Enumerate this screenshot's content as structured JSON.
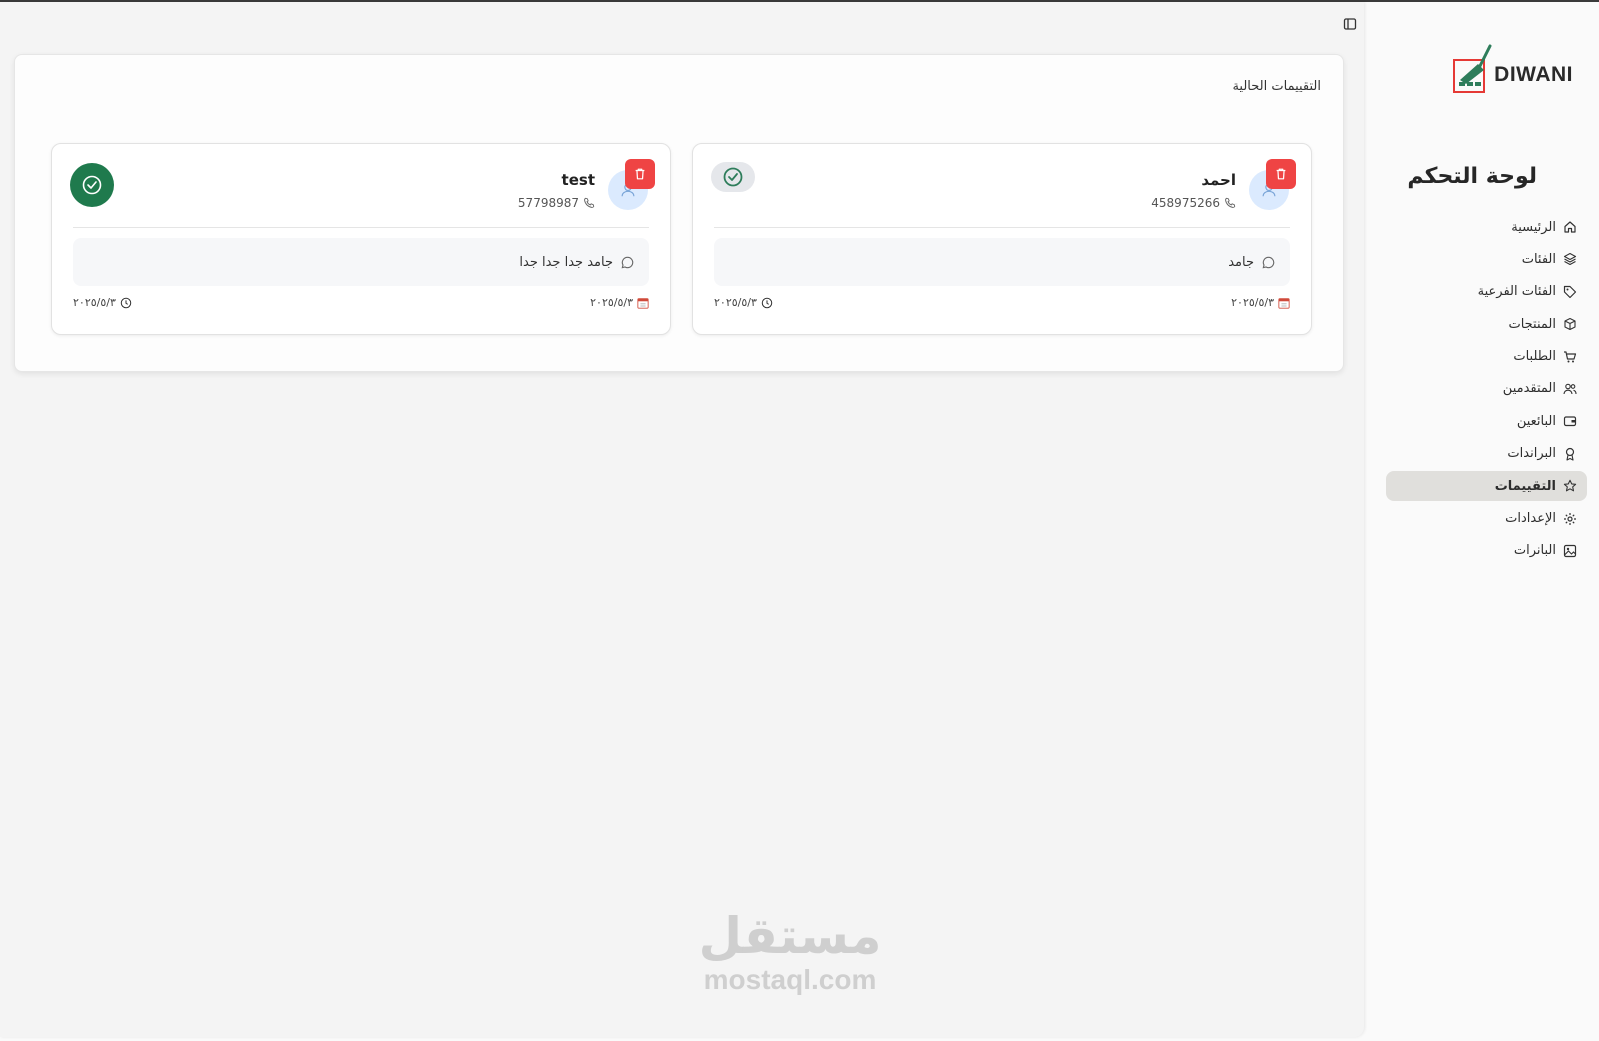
{
  "brand": {
    "logo_text": "DIWANI",
    "accent": "#e53935",
    "green": "#2e7d5b"
  },
  "sidebar": {
    "title": "لوحة التحكم",
    "items": [
      {
        "label": "الرئيسية",
        "icon": "home-icon"
      },
      {
        "label": "الفئات",
        "icon": "layers-icon"
      },
      {
        "label": "الفئات الفرعية",
        "icon": "tag-icon"
      },
      {
        "label": "المنتجات",
        "icon": "box-icon"
      },
      {
        "label": "الطلبات",
        "icon": "cart-icon"
      },
      {
        "label": "المتقدمين",
        "icon": "users-icon"
      },
      {
        "label": "البائعين",
        "icon": "wallet-icon"
      },
      {
        "label": "البراندات",
        "icon": "award-icon"
      },
      {
        "label": "التقييمات",
        "icon": "star-icon",
        "active": true
      },
      {
        "label": "الإعدادات",
        "icon": "gear-icon"
      },
      {
        "label": "البانرات",
        "icon": "image-icon"
      }
    ]
  },
  "main": {
    "panel_title": "التقييمات الحالية",
    "reviews": [
      {
        "name": "احمد",
        "phone": "458975266",
        "comment": "جامد",
        "date": "٢٠٢٥/٥/٣",
        "time_date": "٢٠٢٥/٥/٣",
        "approved": false
      },
      {
        "name": "test",
        "phone": "57798987",
        "comment": "جامد جدا جدا جدا",
        "date": "٢٠٢٥/٥/٣",
        "time_date": "٢٠٢٥/٥/٣",
        "approved": true
      }
    ]
  },
  "watermark": {
    "arabic": "مستقل",
    "latin": "mostaql.com"
  }
}
